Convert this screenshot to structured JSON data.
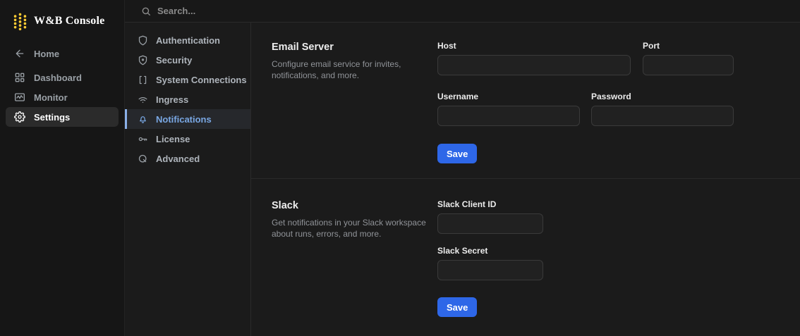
{
  "app": {
    "title": "W&B Console"
  },
  "topbar": {
    "search_placeholder": "Search..."
  },
  "sidebar": {
    "items": [
      {
        "label": "Home",
        "icon": "arrow-left-icon",
        "active": false
      },
      {
        "label": "Dashboard",
        "icon": "grid-icon",
        "active": false
      },
      {
        "label": "Monitor",
        "icon": "monitor-chart-icon",
        "active": false
      },
      {
        "label": "Settings",
        "icon": "gear-icon",
        "active": true
      }
    ]
  },
  "settings_nav": {
    "items": [
      {
        "label": "Authentication",
        "icon": "shield-icon",
        "active": false
      },
      {
        "label": "Security",
        "icon": "shield-check-icon",
        "active": false
      },
      {
        "label": "System Connections",
        "icon": "brackets-icon",
        "active": false
      },
      {
        "label": "Ingress",
        "icon": "wifi-icon",
        "active": false
      },
      {
        "label": "Notifications",
        "icon": "bell-icon",
        "active": true
      },
      {
        "label": "License",
        "icon": "key-icon",
        "active": false
      },
      {
        "label": "Advanced",
        "icon": "advanced-icon",
        "active": false
      }
    ]
  },
  "sections": [
    {
      "title": "Email Server",
      "description": "Configure email service for invites, notifications, and more.",
      "fields": [
        {
          "label": "Host",
          "value": ""
        },
        {
          "label": "Port",
          "value": ""
        },
        {
          "label": "Username",
          "value": ""
        },
        {
          "label": "Password",
          "value": ""
        }
      ],
      "save_label": "Save"
    },
    {
      "title": "Slack",
      "description": "Get notifications in your Slack workspace about runs, errors, and more.",
      "fields": [
        {
          "label": "Slack Client ID",
          "value": ""
        },
        {
          "label": "Slack Secret",
          "value": ""
        }
      ],
      "save_label": "Save"
    }
  ],
  "colors": {
    "accent_blue": "#2e67e8",
    "selected_nav_blue": "#79a7e3",
    "selected_nav_bar": "#8ab0e8",
    "logo_gold": "#ffcc33",
    "background": "#1b1b1b",
    "sidebar_background": "#161616"
  }
}
